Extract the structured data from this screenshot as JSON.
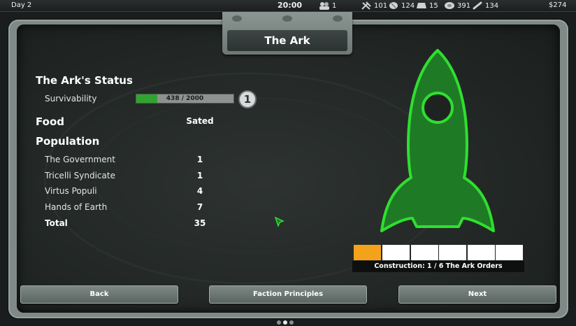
{
  "topbar": {
    "day": "Day 2",
    "clock": "20:00",
    "resources": [
      {
        "icon": "population-icon",
        "value": "1"
      },
      {
        "icon": "tools-icon",
        "value": "101"
      },
      {
        "icon": "food-icon",
        "value": "124"
      },
      {
        "icon": "material-icon",
        "value": "15"
      },
      {
        "icon": "meat-icon",
        "value": "391"
      },
      {
        "icon": "bone-icon",
        "value": "134"
      }
    ],
    "money": "$274"
  },
  "title": "The Ark",
  "status": {
    "heading": "The Ark's Status",
    "survivability_label": "Survivability",
    "survivability_value": 438,
    "survivability_max": 2000,
    "survivability_text": "438 / 2000",
    "survivability_badge": "1",
    "food_label": "Food",
    "food_value": "Sated",
    "population_label": "Population",
    "factions": [
      {
        "name": "The Government",
        "count": "1"
      },
      {
        "name": "Tricelli Syndicate",
        "count": "1"
      },
      {
        "name": "Virtus Populi",
        "count": "4"
      },
      {
        "name": "Hands of Earth",
        "count": "7"
      }
    ],
    "total_label": "Total",
    "total_value": "35"
  },
  "construction": {
    "completed": 1,
    "total": 6,
    "label": "Construction: 1 / 6 The Ark Orders"
  },
  "buttons": {
    "back": "Back",
    "faction_principles": "Faction Principles",
    "next": "Next"
  },
  "pagination": {
    "pages": 3,
    "current": 2
  },
  "colors": {
    "accent_green": "#2fcf2f",
    "rocket_fill": "#1f7a26",
    "survivability_fill": "#2fa52f",
    "construction_done": "#f5a21b"
  }
}
